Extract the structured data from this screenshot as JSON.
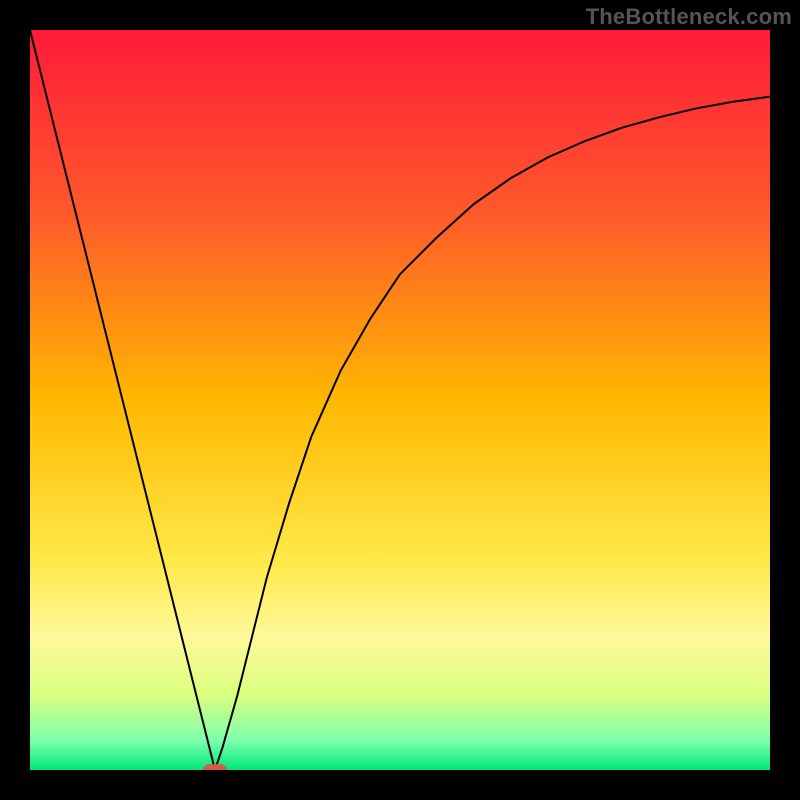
{
  "watermark": "TheBottleneck.com",
  "chart_data": {
    "type": "line",
    "title": "",
    "xlabel": "",
    "ylabel": "",
    "xlim": [
      0,
      100
    ],
    "ylim": [
      0,
      100
    ],
    "grid": false,
    "legend": null,
    "background_gradient": {
      "stops": [
        {
          "offset": 0.0,
          "color": "#ff1a3a"
        },
        {
          "offset": 0.25,
          "color": "#ff5a2a"
        },
        {
          "offset": 0.5,
          "color": "#ffb800"
        },
        {
          "offset": 0.72,
          "color": "#ffe94a"
        },
        {
          "offset": 0.82,
          "color": "#fff99a"
        },
        {
          "offset": 0.9,
          "color": "#d8ff80"
        },
        {
          "offset": 0.96,
          "color": "#7dffad"
        },
        {
          "offset": 1.0,
          "color": "#00e77a"
        }
      ]
    },
    "series": [
      {
        "name": "curve",
        "color": "#000000",
        "width": 2,
        "x": [
          0,
          2,
          4,
          6,
          8,
          10,
          12,
          14,
          16,
          18,
          20,
          22,
          24,
          25,
          26,
          28,
          30,
          32,
          35,
          38,
          42,
          46,
          50,
          55,
          60,
          65,
          70,
          75,
          80,
          85,
          90,
          95,
          100
        ],
        "y": [
          100,
          92,
          84,
          76,
          68,
          60,
          52,
          44,
          36,
          28,
          20,
          12,
          4,
          0,
          3,
          10,
          18,
          26,
          36,
          45,
          54,
          61,
          67,
          72,
          76.5,
          80,
          82.8,
          85,
          86.8,
          88.2,
          89.4,
          90.3,
          91
        ]
      }
    ],
    "marker": {
      "x": 25,
      "y": 0,
      "shape": "rounded-rect",
      "color": "#d45a4a",
      "width": 3.2,
      "height": 1.6
    }
  }
}
